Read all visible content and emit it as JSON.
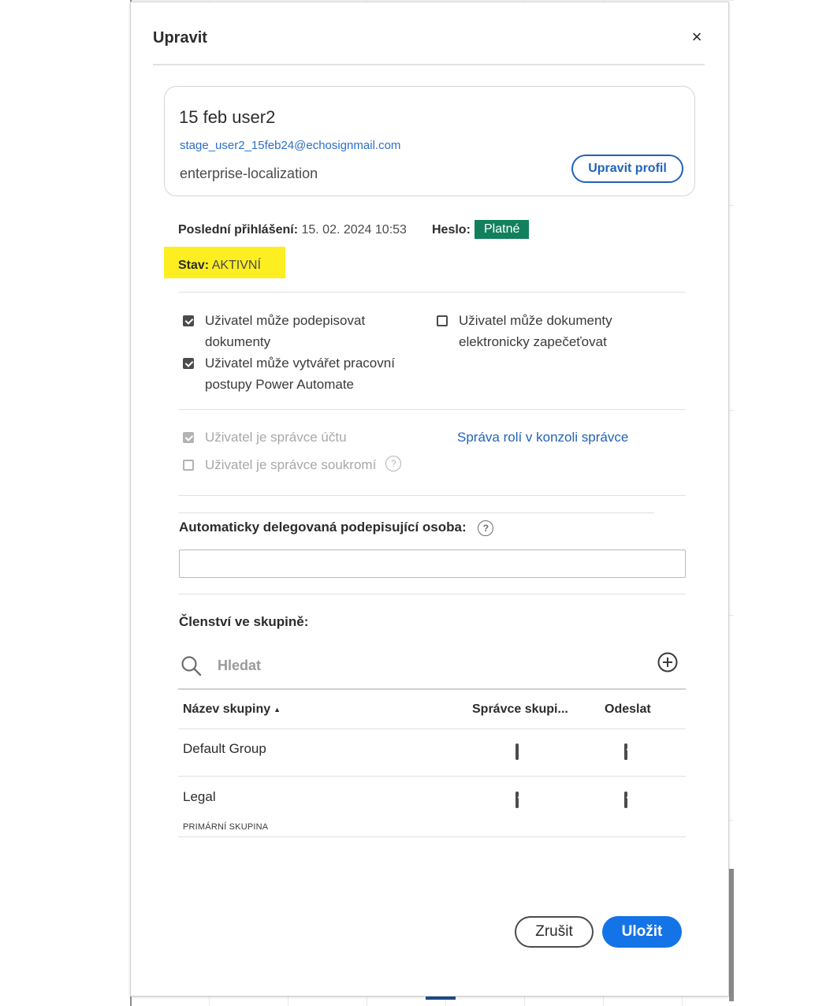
{
  "dialog": {
    "title": "Upravit",
    "close_label": "×"
  },
  "profile": {
    "name": "15 feb user2",
    "email": "stage_user2_15feb24@echosignmail.com",
    "organization": "enterprise-localization",
    "edit_profile_label": "Upravit profil"
  },
  "account": {
    "last_login_label": "Poslední přihlášení:",
    "last_login_value": " 15. 02. 2024 10:53",
    "password_label": "Heslo:",
    "password_status": "Platné",
    "status_label": "Stav:",
    "status_value": " AKTIVNÍ",
    "status_highlight_color": "#fcee21",
    "password_badge_color": "#12805c"
  },
  "permissions": {
    "can_sign_line1": "Uživatel může podepisovat",
    "can_sign_line2": "dokumenty",
    "can_sign_checked": true,
    "power_automate_line1": "Uživatel může vytvářet pracovní",
    "power_automate_line2": "postupy Power Automate",
    "power_automate_checked": true,
    "e_seal_line1": "Uživatel může dokumenty",
    "e_seal_line2": "elektronicky zapečeťovat",
    "e_seal_checked": false
  },
  "admin": {
    "account_admin_label": "Uživatel je správce účtu",
    "account_admin_checked": true,
    "privacy_admin_label": "Uživatel je správce soukromí",
    "privacy_admin_checked": false,
    "role_management_link": "Správa rolí v konzoli správce"
  },
  "delegation": {
    "label": "Automaticky delegovaná podepisující osoba:",
    "value": ""
  },
  "groups": {
    "section_label": "Členství ve skupině:",
    "search_placeholder": "Hledat",
    "columns": {
      "name": "Název skupiny",
      "group_admin": "Správce skupi...",
      "send": "Odeslat"
    },
    "rows": [
      {
        "name": "Default Group",
        "subtitle": "",
        "group_admin": false,
        "send": true
      },
      {
        "name": "Legal",
        "subtitle": "PRIMÁRNÍ SKUPINA",
        "group_admin": true,
        "send": true
      }
    ]
  },
  "footer": {
    "cancel_label": "Zrušit",
    "save_label": "Uložit",
    "save_color": "#1473e6"
  }
}
